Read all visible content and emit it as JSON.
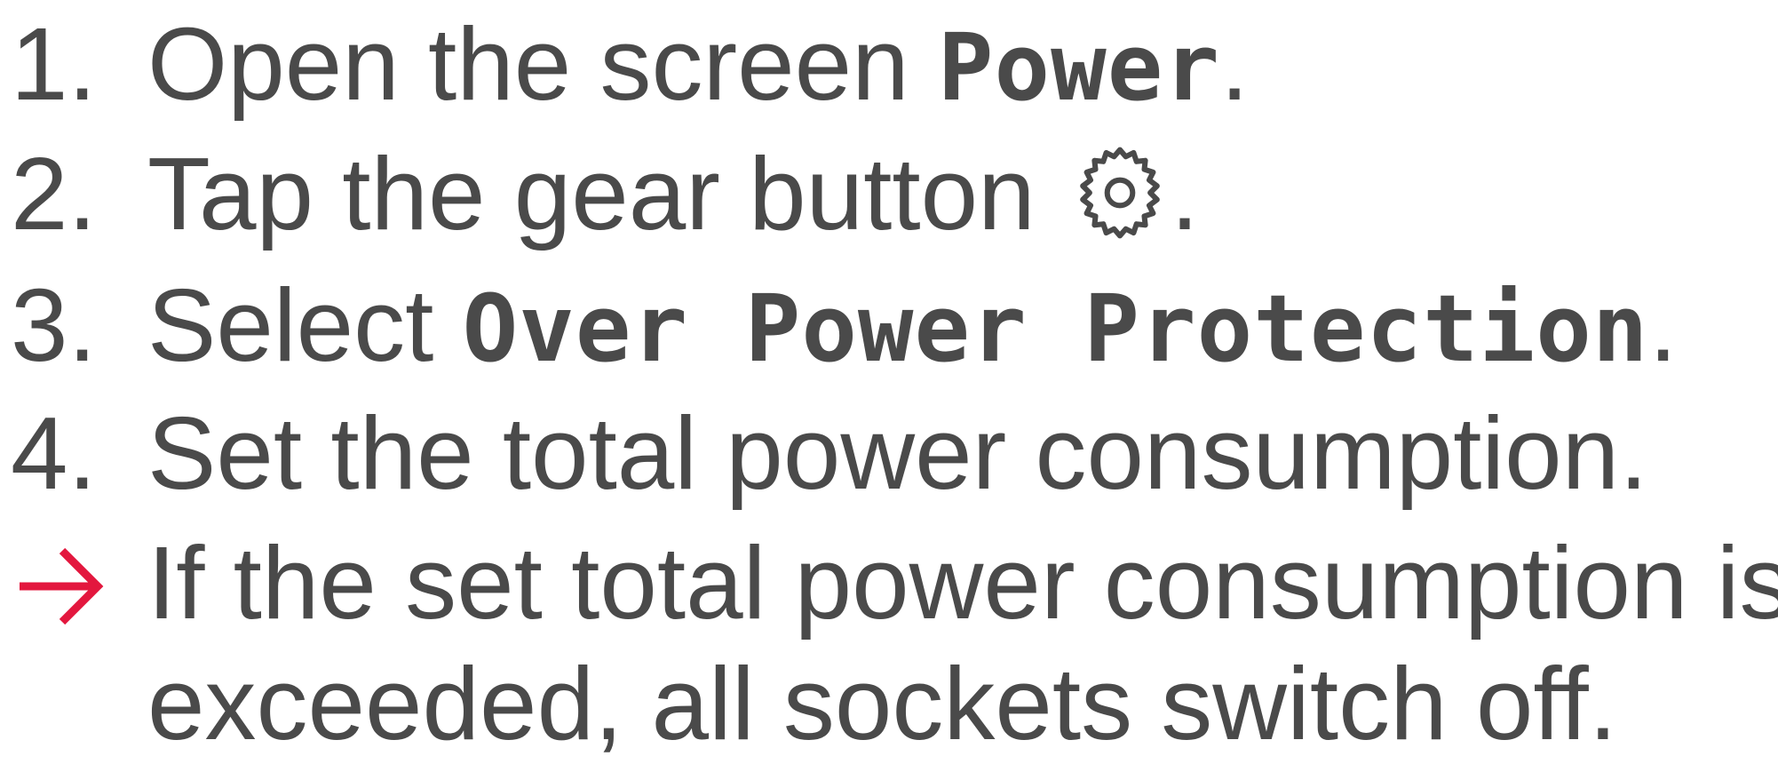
{
  "steps": [
    {
      "number": "1.",
      "text_before": "Open the screen ",
      "ui_term": "Power",
      "text_after": "."
    },
    {
      "number": "2.",
      "text_before": "Tap the gear button ",
      "icon": "gear-icon",
      "text_after": "."
    },
    {
      "number": "3.",
      "text_before": "Select ",
      "ui_term": "Over Power Protection",
      "text_after": "."
    },
    {
      "number": "4.",
      "text": "Set the total power consumption."
    }
  ],
  "result": {
    "icon": "result-arrow-icon",
    "line1": "If the set total power consumption is",
    "line2": "exceeded, all sockets switch off."
  },
  "colors": {
    "text": "#4a4a4a",
    "accent_arrow": "#e3173e"
  }
}
